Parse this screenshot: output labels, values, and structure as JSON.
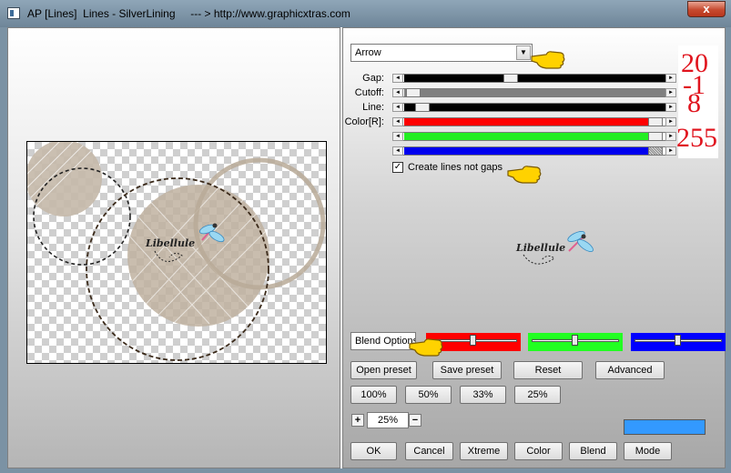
{
  "window": {
    "title": "AP [Lines]  Lines - SilverLining     --- > http://www.graphicxtras.com",
    "close_glyph": "x"
  },
  "mode_dropdown": {
    "value": "Arrow",
    "arrow_glyph": "▼"
  },
  "sliders": {
    "gap": {
      "label": "Gap:",
      "value": "20"
    },
    "cutoff": {
      "label": "Cutoff:",
      "value": "-1"
    },
    "line": {
      "label": "Line:",
      "value": "8"
    },
    "color": {
      "label": "Color[R]:",
      "value": "255"
    },
    "arrow_left": "◄",
    "arrow_right": "►"
  },
  "checkbox": {
    "label": "Create lines not gaps",
    "checked": true,
    "glyph": "✓"
  },
  "watermark": {
    "text": "Libellule"
  },
  "blend": {
    "select_value": "Blend Options",
    "red": "#ff0000",
    "green": "#22ff22",
    "blue": "#0000ff"
  },
  "buttons": {
    "open_preset": "Open preset",
    "save_preset": "Save preset",
    "reset": "Reset",
    "advanced": "Advanced",
    "z100": "100%",
    "z50": "50%",
    "z33": "33%",
    "z25": "25%",
    "ok": "OK",
    "cancel": "Cancel",
    "xtreme": "Xtreme",
    "color": "Color",
    "blend": "Blend",
    "mode": "Mode"
  },
  "zoom": {
    "plus": "+",
    "minus": "−",
    "value": "25%"
  },
  "colors": {
    "swatch": "#3399ff",
    "pointer": "#ffd200"
  },
  "icons": [
    "pointing-hand-icon",
    "dragonfly-icon",
    "app-icon",
    "close-icon"
  ]
}
